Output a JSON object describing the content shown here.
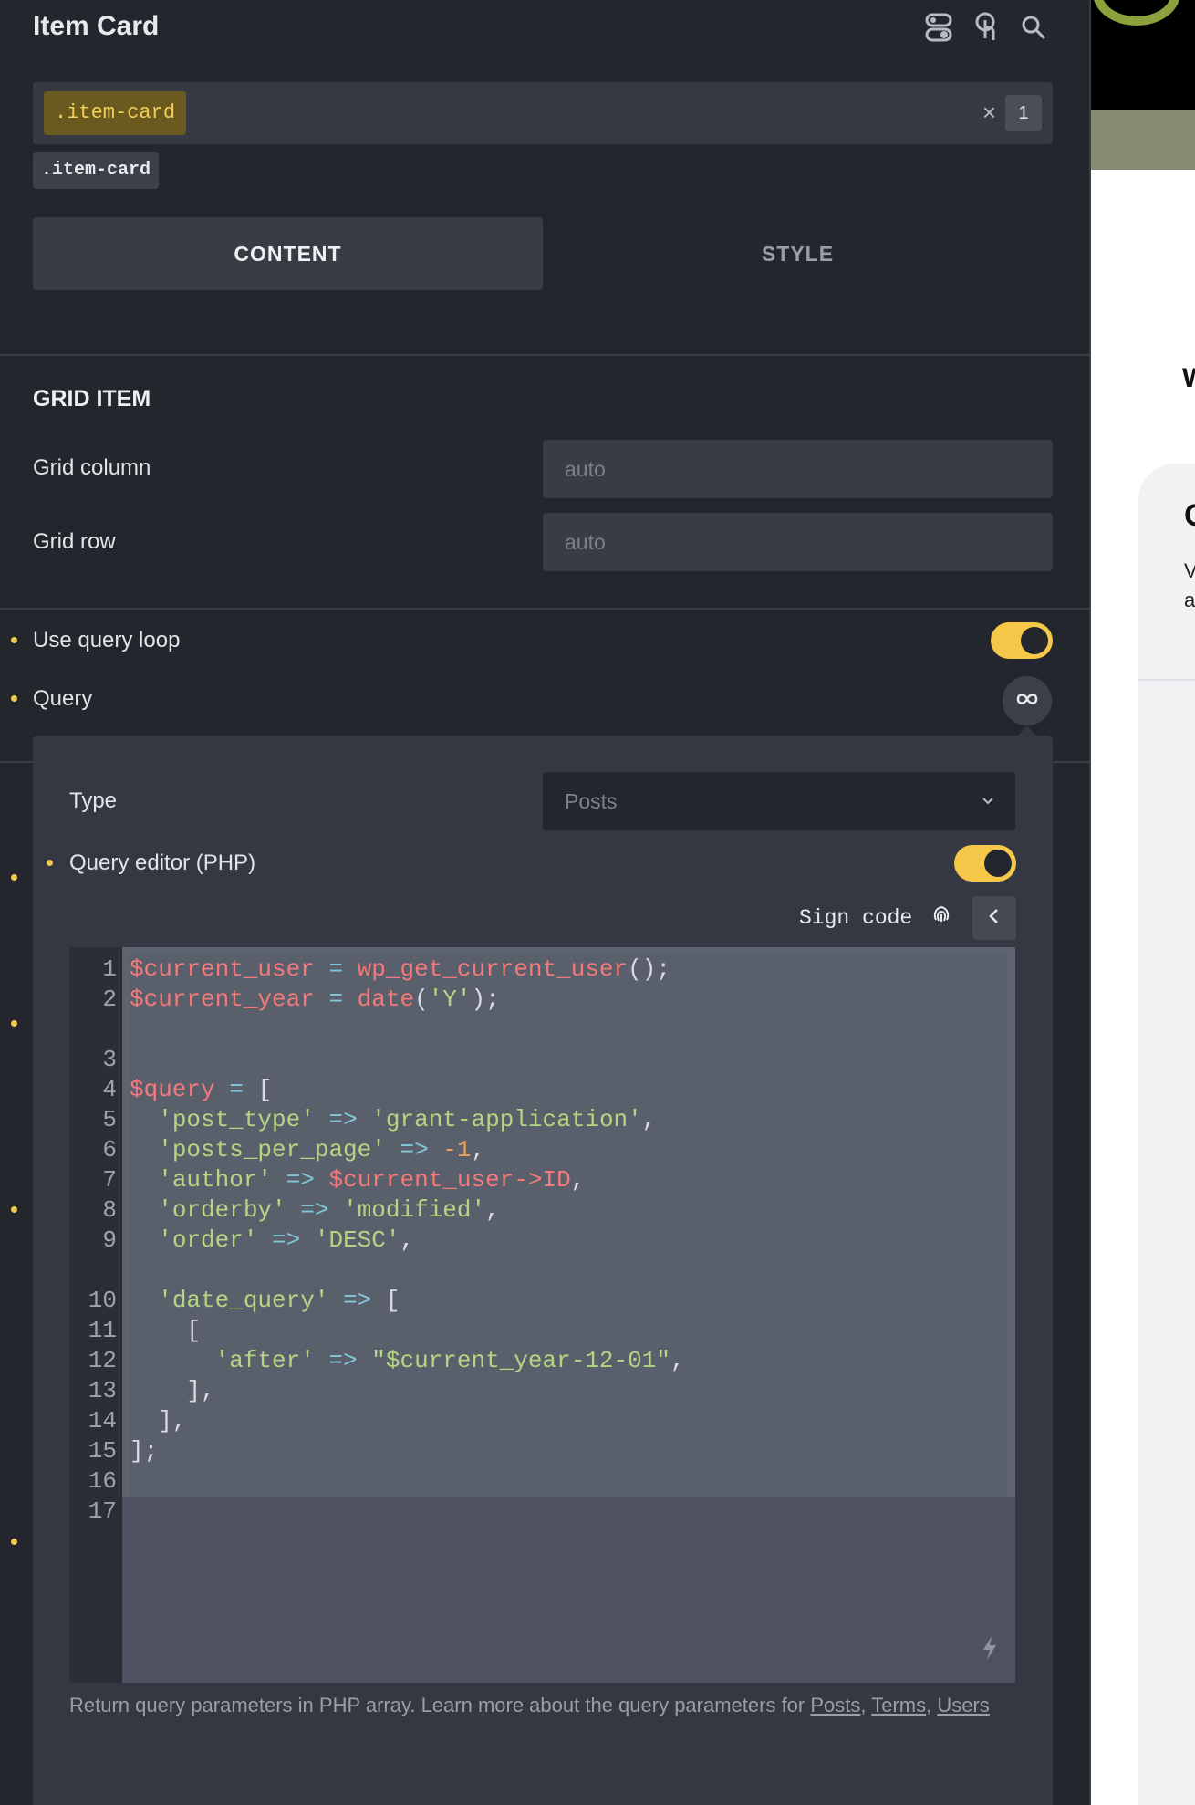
{
  "header": {
    "title": "Item Card",
    "icons": [
      "toggle-settings-icon",
      "touch-pointer-icon",
      "search-icon"
    ]
  },
  "selector": {
    "chip": ".item-card",
    "clear": "×",
    "count": "1",
    "sub_chip": ".item-card"
  },
  "tabs": [
    {
      "label": "CONTENT"
    },
    {
      "label": "STYLE"
    }
  ],
  "grid_item": {
    "title": "GRID ITEM",
    "column_label": "Grid column",
    "column_placeholder": "auto",
    "row_label": "Grid row",
    "row_placeholder": "auto"
  },
  "query_loop": {
    "label": "Use query loop",
    "enabled": true
  },
  "query": {
    "label": "Query",
    "icon": "infinity-icon"
  },
  "popup": {
    "type_label": "Type",
    "type_value": "Posts",
    "editor_label": "Query editor (PHP)",
    "editor_enabled": true,
    "sign_code": "Sign code",
    "code_lines": [
      {
        "n": "1",
        "t": "$current_user = wp_get_current_user();"
      },
      {
        "n": "2",
        "t": "$current_year = date('Y');"
      },
      {
        "n": "",
        "t": ""
      },
      {
        "n": "3",
        "t": ""
      },
      {
        "n": "4",
        "t": "$query = ["
      },
      {
        "n": "5",
        "t": "  'post_type' => 'grant-application',"
      },
      {
        "n": "6",
        "t": "  'posts_per_page' => -1,"
      },
      {
        "n": "7",
        "t": "  'author' => $current_user->ID,"
      },
      {
        "n": "8",
        "t": "  'orderby' => 'modified',"
      },
      {
        "n": "9",
        "t": "  'order' => 'DESC',"
      },
      {
        "n": "",
        "t": ""
      },
      {
        "n": "10",
        "t": "  'date_query' => ["
      },
      {
        "n": "11",
        "t": "    ["
      },
      {
        "n": "12",
        "t": "      'after' => \"$current_year-12-01\","
      },
      {
        "n": "13",
        "t": "    ],"
      },
      {
        "n": "14",
        "t": "  ],"
      },
      {
        "n": "15",
        "t": "];"
      },
      {
        "n": "16",
        "t": ""
      },
      {
        "n": "17",
        "t": ""
      }
    ],
    "help_text": "Return query parameters in PHP array. Learn more about the query parameters for ",
    "help_links": [
      "Posts",
      "Terms",
      "Users"
    ]
  },
  "preview": {
    "heading_fragment": "W",
    "card_title_fragment": "C",
    "card_text_fragment": "V a"
  },
  "colors": {
    "accent": "#f5c84a",
    "panel": "#23262d",
    "popup": "#353842"
  }
}
